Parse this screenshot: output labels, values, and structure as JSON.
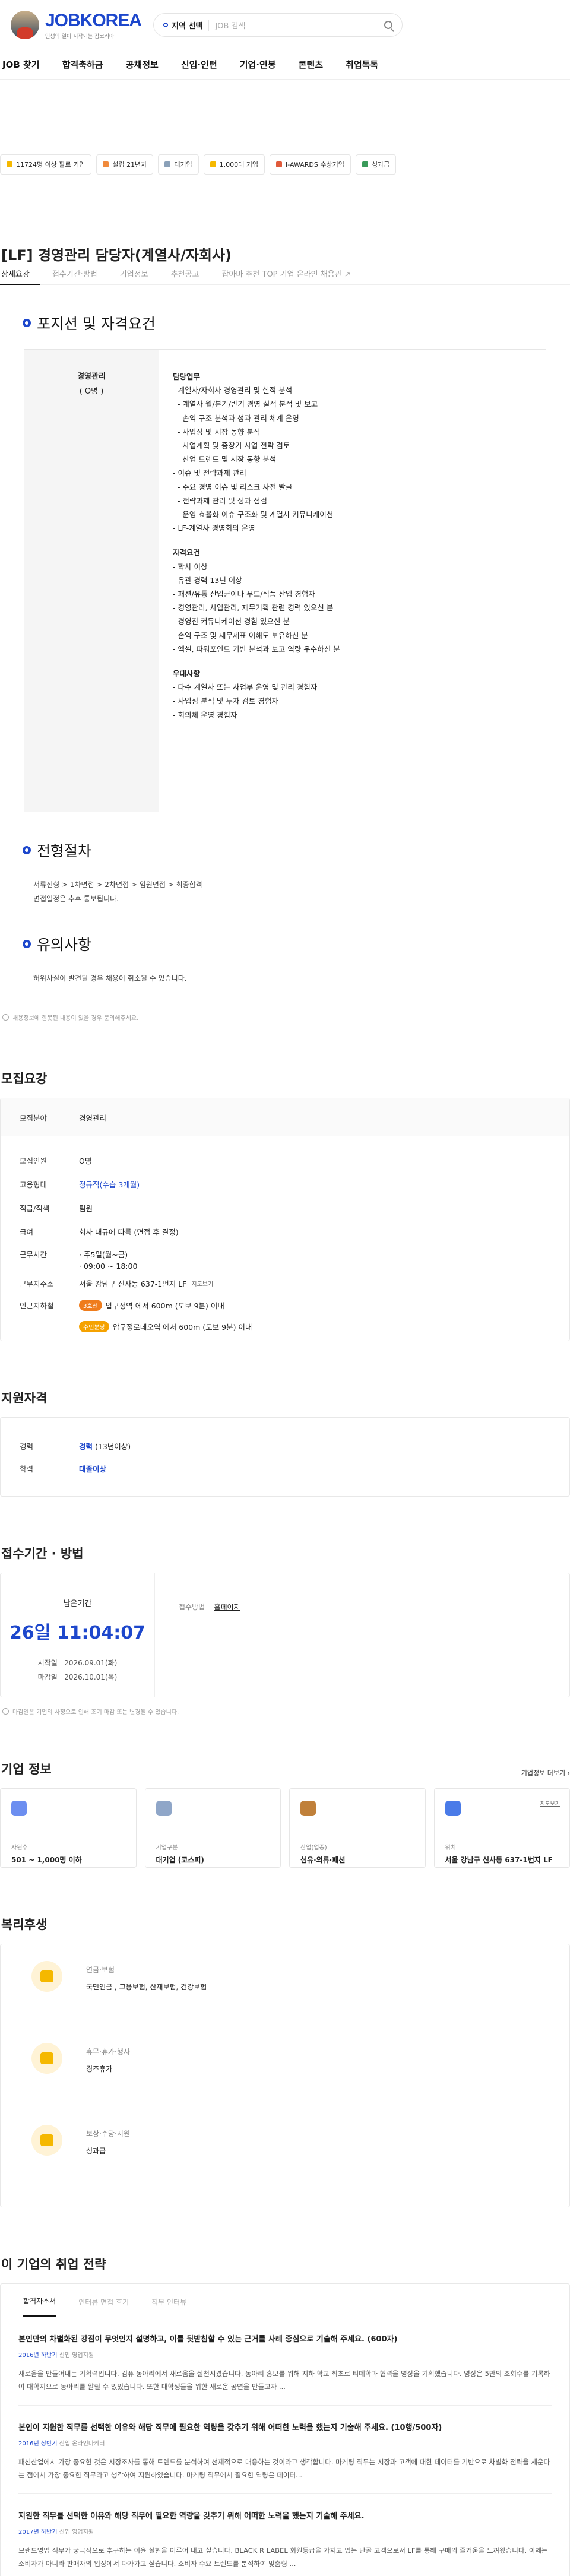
{
  "header": {
    "logo_text": "JOBKOREA",
    "logo_sub": "인생의 일이 시작되는 잡코리아",
    "location": "지역 선택",
    "search_placeholder": "JOB 검색"
  },
  "nav": [
    "JOB 찾기",
    "합격축하금",
    "공채정보",
    "신입·인턴",
    "기업·연봉",
    "콘텐츠",
    "취업톡톡"
  ],
  "chips": [
    {
      "label": "11724명 이상 팔로 기업",
      "color": "#f5b800"
    },
    {
      "label": "설립 21년차",
      "color": "#f08a3c"
    },
    {
      "label": "대기업",
      "color": "#8aa0b8"
    },
    {
      "label": "1,000대 기업",
      "color": "#f5b800"
    },
    {
      "label": "I-AWARDS 수상기업",
      "color": "#e05a3a"
    },
    {
      "label": "성과급",
      "color": "#3a9a5a"
    }
  ],
  "title": "[LF] 경영관리 담당자(계열사/자회사)",
  "tabs": [
    "상세요강",
    "접수기간·방법",
    "기업정보",
    "추천공고",
    "잡아바 추천 TOP 기업 온라인 채용관 ↗"
  ],
  "s1": "포지션 및 자격요건",
  "pos": {
    "name": "경영관리",
    "count": "( O명 )"
  },
  "duty": {
    "h": "담당업무",
    "items": [
      "- 계열사/자회사 경영관리 및 실적 분석",
      "  - 계열사 월/분기/반기 경영 실적 분석 및 보고",
      "  - 손익 구조 분석과 성과 관리 체계 운영",
      "  - 사업성 및 시장 동향 분석",
      "  - 사업계획 및 중장기 사업 전략 검토",
      "  - 산업 트렌드 및 시장 동향 분석",
      "- 이슈 및 전략과제 관리",
      "  - 주요 경영 이슈 및 리스크 사전 발굴",
      "  - 전략과제 관리 및 성과 점검",
      "  - 운영 효율화 이슈 구조화 및 계열사 커뮤니케이션",
      "- LF-계열사 경영회의 운영"
    ]
  },
  "qual": {
    "h": "자격요건",
    "items": [
      "- 학사 이상",
      "- 유관 경력 13년 이상",
      "- 패션/유통 산업군이나 푸드/식품 산업 경험자",
      "- 경영관리, 사업관리, 재무기획 관련 경력 있으신 분",
      "- 경영진 커뮤니케이션 경험 있으신 분",
      "- 손익 구조 및 재무제표 이해도 보유하신 분",
      "- 엑셀, 파워포인트 기반 분석과 보고 역량 우수하신 분"
    ]
  },
  "pref": {
    "h": "우대사항",
    "items": [
      "- 다수 계열사 또는 사업부 운영 및 관리 경험자",
      "- 사업성 분석 및 투자 검토 경험자",
      "- 회의체 운영 경험자"
    ]
  },
  "s2": "전형절차",
  "process": [
    "서류전형 > 1차면접 > 2차면접 > 임원면접 > 최종합격",
    "면접일정은 추후 통보됩니다."
  ],
  "s3": "유의사항",
  "caution": "허위사실이 발견될 경우 채용이 취소될 수 있습니다.",
  "note1": "채용정보에 잘못된 내용이 있을 경우 문의해주세요.",
  "recruit": {
    "h": "모집요강",
    "rows": [
      [
        "모집분야",
        "경영관리"
      ],
      [
        "모집인원",
        "O명"
      ],
      [
        "고용형태",
        "정규직(수습 3개월)"
      ],
      [
        "직급/직책",
        "팀원"
      ],
      [
        "급여",
        "회사 내규에 따름 (면접 후 결정)"
      ],
      [
        "근무시간",
        "· 주5일(월~금)"
      ],
      [
        "근무시간2",
        "· 09:00 ~ 18:00"
      ],
      [
        "근무지주소",
        "서울 강남구 신사동 637-1번지 LF"
      ],
      [
        "인근지하철",
        "압구정역 에서 600m (도보 9분) 이내"
      ],
      [
        "인근지하철2",
        "압구정로데오역 에서 600m (도보 9분) 이내"
      ]
    ],
    "map": "지도보기",
    "tag1": "3호선",
    "tag2": "수인분당"
  },
  "qualif": {
    "h": "지원자격",
    "rows": [
      [
        "경력",
        "경력",
        "(13년이상)"
      ],
      [
        "학력",
        "대졸이상",
        ""
      ]
    ]
  },
  "apply": {
    "h": "접수기간 · 방법",
    "remain": "남은기간",
    "time": "26일 11:04:07",
    "start_k": "시작일",
    "start": "2026.09.01(화)",
    "end_k": "마감일",
    "end": "2026.10.01(목)",
    "method_k": "접수방법",
    "method": "홈페이지"
  },
  "note2": "마감일은 기업의 사정으로 인해 조기 마감 또는 변경될 수 있습니다.",
  "company": {
    "h": "기업 정보",
    "more": "기업정보 더보기 ›",
    "cards": [
      {
        "lb": "사원수",
        "vl": "501 ~ 1,000명 이하",
        "c": "#6c8ef0"
      },
      {
        "lb": "기업구분",
        "vl": "대기업 (코스피)",
        "c": "#8fa6c8"
      },
      {
        "lb": "산업(업종)",
        "vl": "섬유·의류·패션",
        "c": "#c0803a"
      },
      {
        "lb": "위치",
        "vl": "서울 강남구 신사동 637-1번지 LF",
        "c": "#4a7be8"
      }
    ],
    "map": "지도보기"
  },
  "benefit": {
    "h": "복리후생",
    "items": [
      {
        "t": "연금·보험",
        "v": "국민연금 , 고용보험, 산재보험, 건강보험"
      },
      {
        "t": "휴무·휴가·행사",
        "v": "경조휴가"
      },
      {
        "t": "보상·수당·지원",
        "v": "성과급"
      }
    ]
  },
  "strategy": {
    "h": "이 기업의 취업 전략",
    "tabs": [
      "합격자소서",
      "인터뷰 면접 후기",
      "직무 인터뷰"
    ],
    "items": [
      {
        "q": "본인만의 차별화된 강점이 무엇인지 설명하고, 이를 뒷받침할 수 있는 근거를 사례 중심으로 기술해 주세요. (600자)",
        "y": "2016년 하반기",
        "t": "신입",
        "r": "영업지원",
        "a": "새로움을 만들어내는 기획력입니다. 컴퓨 동아리에서 새로움을 실천시켰습니다. 동아리 홍보를 위해 지하 학교 최초로 티데학과 협력을 영상을 기획했습니다. 영상은 5만의 조회수를 기록하여 대학지으로 동아리를 알릴 수 있었습니다. 또한 대학생들을 위한 새로운 공연을 만들고자 ..."
      },
      {
        "q": "본인이 지원한 직무를 선택한 이유와 해당 직무에 필요한 역량을 갖추기 위해 어떠한 노력을 했는지 기술해 주세요. (10행/500자)",
        "y": "2016년 상반기",
        "t": "신입",
        "r": "온라인마케터",
        "a": "패션산업에서 가장 중요한 것은 시장조사를 통해 트렌드를 분석하여 선제적으로 대응하는 것이라고 생각합니다. 마케팅 직무는 시장과 고객에 대한 데이터를 기반으로 차별화 전략을 세운다는 점에서 가장 중요한 직무라고 생각하여 지원하였습니다. 마케팅 직무에서 필요한 역량은 데이터..."
      },
      {
        "q": "지원한 직무를 선택한 이유와 해당 직무에 필요한 역량을 갖추기 위해 어떠한 노력을 했는지 기술해 주세요.",
        "y": "2017년 하반기",
        "t": "신입",
        "r": "영업지원",
        "a": "브랜드영업 직무가 궁극적으로 추구하는 이윤 실현을 이루어 내고 싶습니다. BLACK R LABEL 회원등급을 가지고 있는 단골 고객으로서 LF를 통해 구매의 즐거움을 느껴왔습니다. 이제는 소비자가 아니라 판매자의 입장에서 다가가고 싶습니다. 소비자 수요 트렌드를 분석하여 맞춤형 ..."
      }
    ]
  }
}
